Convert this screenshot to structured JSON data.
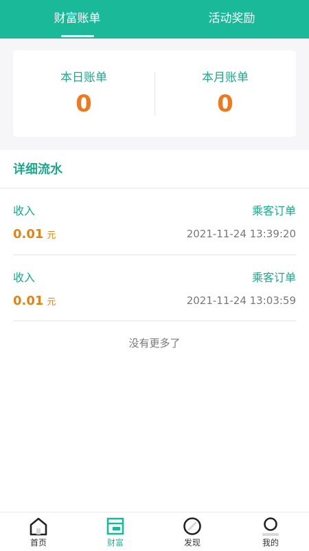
{
  "colors": {
    "brand": "#19b99a",
    "accent_text": "#19a98c",
    "amount": "#e08515",
    "summary_value": "#ee7a20",
    "muted": "#777777"
  },
  "top_tabs": [
    {
      "label": "财富账单",
      "active": true
    },
    {
      "label": "活动奖励",
      "active": false
    }
  ],
  "summary": {
    "today_label": "本日账单",
    "today_value": "0",
    "month_label": "本月账单",
    "month_value": "0"
  },
  "section_title": "详细流水",
  "records": [
    {
      "type": "收入",
      "source": "乘客订单",
      "amount": "0.01",
      "unit": "元",
      "time": "2021-11-24 13:39:20"
    },
    {
      "type": "收入",
      "source": "乘客订单",
      "amount": "0.01",
      "unit": "元",
      "time": "2021-11-24 13:03:59"
    }
  ],
  "no_more_text": "没有更多了",
  "bottom_nav": [
    {
      "label": "首页",
      "icon": "home-icon",
      "active": false
    },
    {
      "label": "财富",
      "icon": "wallet-icon",
      "active": true
    },
    {
      "label": "发现",
      "icon": "compass-icon",
      "active": false
    },
    {
      "label": "我的",
      "icon": "user-icon",
      "active": false
    }
  ]
}
